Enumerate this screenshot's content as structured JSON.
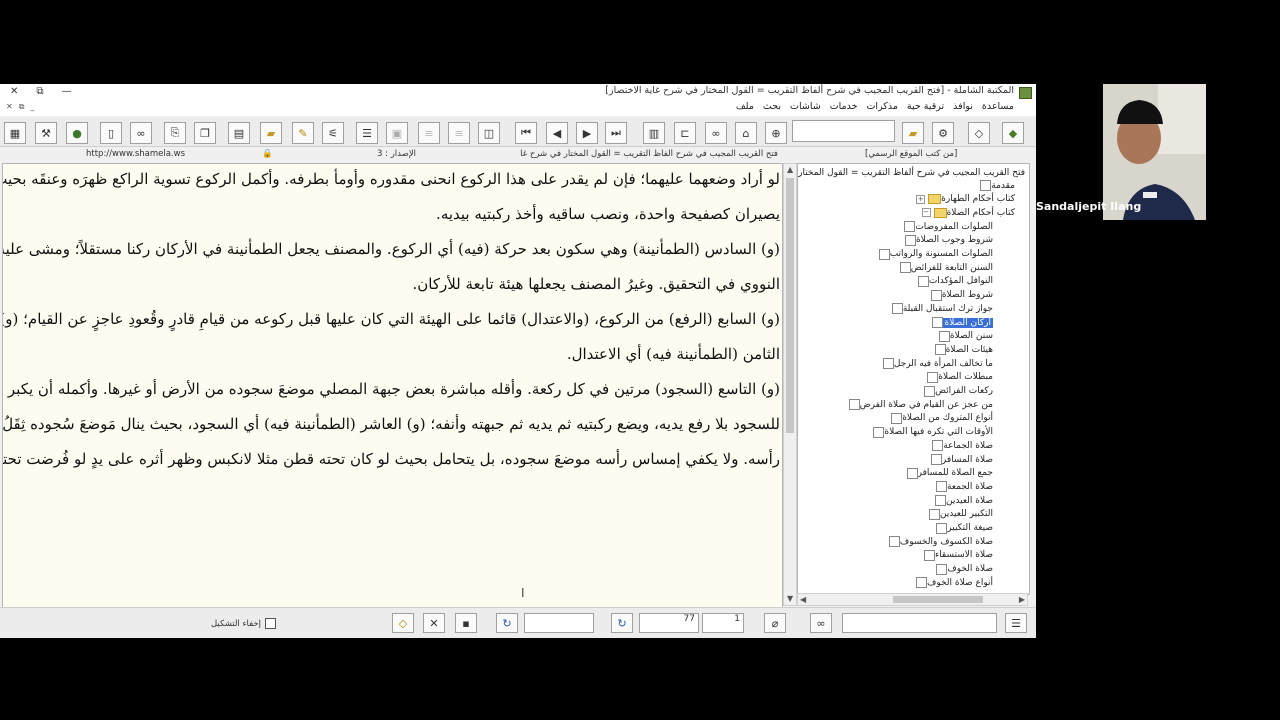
{
  "window": {
    "title": "المكتبة الشاملة - [فتح القريب المجيب في شرح ألفاظ التقريب = القول المختار في شرح غاية الاختصار]",
    "controls": [
      "✕",
      "⧉",
      "—"
    ]
  },
  "menu": [
    "ملف",
    "بحث",
    "شاشات",
    "خدمات",
    "مذكرات",
    "ترقية حية",
    "نوافذ",
    "مساعدة"
  ],
  "statusline": {
    "url": "http://www.shamela.ws",
    "edition": "الإصدار : 3",
    "book_title": "فتح القريب المجيب في شرح ألفاظ التقريب = القول المختار في شرح غاية الاختصار",
    "category": "[من كتب الموقع الرسمي]"
  },
  "text_lines": [
    "لو أراد وضعهما عليهما؛ فإن لم يقدر على هذا الركوع انحنى مقدوره وأومأ بطرفه. وأكمل الركوع تسوية الراكع ظهرَه وعنقَه بحيث",
    "يصيران كصفيحة واحدة، ونصب ساقيه وأخذ ركبتيه بيديه.",
    "(و) السادس (الطمأنينة) وهي سكون بعد حركة (فيه) أي الركوع. والمصنف يجعل الطمأنينة في الأركان ركنا مستقلاً؛ ومشى عليه",
    "النووي في التحقيق. وغيرُ المصنف يجعلها هيئة تابعة للأركان.",
    "(و) السابع (الرفع) من الركوع، (والاعتدال) قائما على الهيئة التي كان عليها قبل ركوعه من قيامِ قادرٍ وقُعودِ عاجزٍ عن القيام؛ (و)",
    "الثامن (الطمأنينة فيه) أي الاعتدال.",
    "(و) التاسع (السجود) مرتين في كل ركعة. وأقله مباشرة بعض جبهة المصلي موضعَ سجوده من الأرض أو غيرها. وأكمله أن يكبر لهويه",
    "للسجود بلا رفع يديه، ويضع ركبتيه ثم يديه ثم جبهته وأنفه؛ (و) العاشر (الطمأنينة فيه) أي السجود، بحيث ينال مَوضعَ سُجوده ثِقَلُ",
    "رأسه. ولا يكفي إمساس رأسه موضعَ سجوده، بل يتحامل بحيث لو كان تحته قطن مثلا لانكبس وظهر أثره على يدٍ لو فُرضت تحته."
  ],
  "tree": {
    "root": "فتح القريب المجيب في شرح ألفاظ التقريب = القول المختار في",
    "items": [
      {
        "label": "مقدمة",
        "level": 1
      },
      {
        "label": "كتاب أحكام الطهارة",
        "level": 1
      },
      {
        "label": "كتاب أحكام الصلاة",
        "level": 1
      },
      {
        "label": "الصلوات المفروضات",
        "level": 2
      },
      {
        "label": "شروط وجوب الصلاة",
        "level": 2
      },
      {
        "label": "الصلوات المسنونة والرواتب",
        "level": 2
      },
      {
        "label": "السنن التابعة للفرائض",
        "level": 2
      },
      {
        "label": "النوافل المؤكدات",
        "level": 2
      },
      {
        "label": "شروط الصلاة",
        "level": 2
      },
      {
        "label": "جواز ترك استقبال القبلة",
        "level": 2
      },
      {
        "label": "أركان الصلاة",
        "level": 2,
        "selected": true
      },
      {
        "label": "سنن الصلاة",
        "level": 2
      },
      {
        "label": "هيئات الصلاة",
        "level": 2
      },
      {
        "label": "ما تخالف المرأة فيه الرجل",
        "level": 2
      },
      {
        "label": "مبطلات الصلاة",
        "level": 2
      },
      {
        "label": "ركعات الفرائض",
        "level": 2
      },
      {
        "label": "من عجز عن القيام في صلاة الفرض",
        "level": 2
      },
      {
        "label": "أنواع المتروك من الصلاة",
        "level": 2
      },
      {
        "label": "الأوقات التي تكره فيها الصلاة",
        "level": 2
      },
      {
        "label": "صلاة الجماعة",
        "level": 2
      },
      {
        "label": "صلاة المسافر",
        "level": 2
      },
      {
        "label": "جمع الصلاة للمسافر",
        "level": 2
      },
      {
        "label": "صلاة الجمعة",
        "level": 2
      },
      {
        "label": "صلاة العيدين",
        "level": 2
      },
      {
        "label": "التكبير للعيدين",
        "level": 2
      },
      {
        "label": "صيغة التكبير",
        "level": 2
      },
      {
        "label": "صلاة الكسوف والخسوف",
        "level": 2
      },
      {
        "label": "صلاة الاستسقاء",
        "level": 2
      },
      {
        "label": "صلاة الخوف",
        "level": 2
      },
      {
        "label": "أنواع صلاة الخوف",
        "level": 2
      }
    ]
  },
  "bottombar": {
    "hide_diacritics_label": "إخفاء التشكيل",
    "part_value": "77",
    "page_value": "1"
  },
  "video": {
    "participant_name": "Sandaljepit Ilang"
  },
  "colors": {
    "text_bg": "#fefcf0",
    "selection": "#3a6fd8",
    "toolbar": "#ececec"
  }
}
